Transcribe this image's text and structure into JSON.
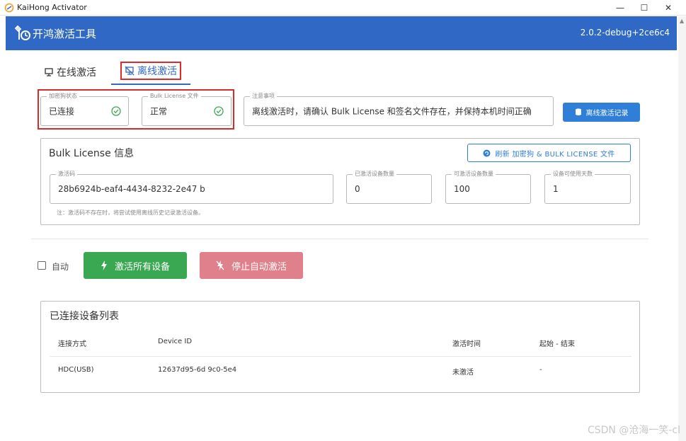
{
  "window": {
    "title": "KaiHong Activator",
    "controls": {
      "minimize": "—",
      "maximize": "☐",
      "close": "✕"
    }
  },
  "header": {
    "app_title": "开鸿激活工具",
    "version": "2.0.2-debug+2ce6c4"
  },
  "tabs": [
    {
      "label": "在线激活",
      "icon": "monitor-icon",
      "active": false
    },
    {
      "label": "离线激活",
      "icon": "monitor-off-icon",
      "active": true
    }
  ],
  "status": {
    "dongle": {
      "legend": "加密狗状态",
      "value": "已连接"
    },
    "license_file": {
      "legend": "Bulk License 文件",
      "value": "正常"
    },
    "notice": {
      "legend": "注意事项",
      "value": "离线激活时，请确认 Bulk License 和签名文件存在，并保持本机时间正确"
    },
    "history_button": "离线激活记录"
  },
  "license_info": {
    "title": "Bulk License 信息",
    "refresh_button": "刷新 加密狗 & BULK LICENSE 文件",
    "fields": {
      "activation_code": {
        "legend": "激活码",
        "value": "28b6924b-eaf4-4434-8232-2e47     b"
      },
      "activated_count": {
        "legend": "已激活设备数量",
        "value": "0"
      },
      "activatable_count": {
        "legend": "可激活设备数量",
        "value": "100"
      },
      "usable_days": {
        "legend": "设备可使用天数",
        "value": "1"
      }
    },
    "note": "注：激活码不存在时，将尝试使用离线历史记录激活设备。"
  },
  "actions": {
    "auto_label": "自动",
    "auto_checked": false,
    "activate_all": "激活所有设备",
    "stop_auto": "停止自动激活"
  },
  "devices": {
    "title": "已连接设备列表",
    "columns": [
      "连接方式",
      "Device ID",
      "激活时间",
      "起始 - 结束"
    ],
    "rows": [
      [
        "HDC(USB)",
        "12637d95-6d      9c0-5e4",
        "未激活",
        "-"
      ]
    ]
  },
  "watermark": "CSDN @沧海一笑-cl",
  "colors": {
    "header_blue": "#2f68c5",
    "accent_blue": "#2f7ed8",
    "ok_green": "#3aa853",
    "stop_red": "#e0808a",
    "highlight_red": "#d92b2b"
  }
}
